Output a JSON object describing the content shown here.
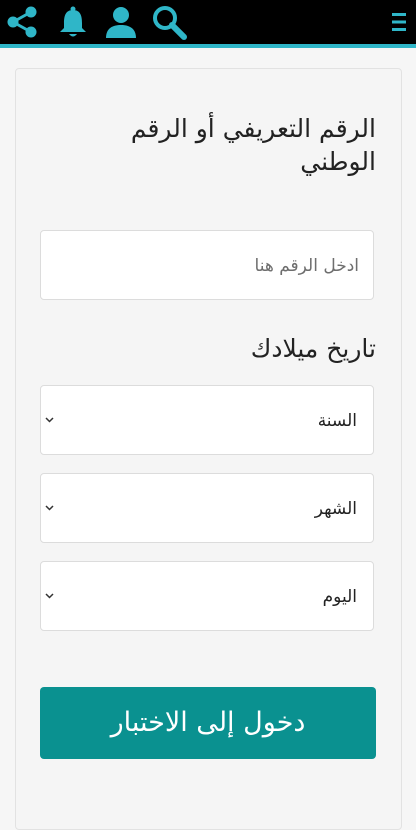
{
  "colors": {
    "topbar_bg": "#000000",
    "accent": "#2fb6c8",
    "button_bg": "#0a9190"
  },
  "topbar": {
    "icons": [
      "share-icon",
      "bell-icon",
      "user-icon",
      "search-icon",
      "menu-icon"
    ]
  },
  "form": {
    "id_label_line1": "الرقم التعريفي أو الرقم",
    "id_label_line2": "الوطني",
    "id_placeholder": "ادخل الرقم هنا",
    "dob_label": "تاريخ ميلادك",
    "year_select": "السنة",
    "month_select": "الشهر",
    "day_select": "اليوم",
    "submit_label": "دخول إلى الاختبار"
  }
}
